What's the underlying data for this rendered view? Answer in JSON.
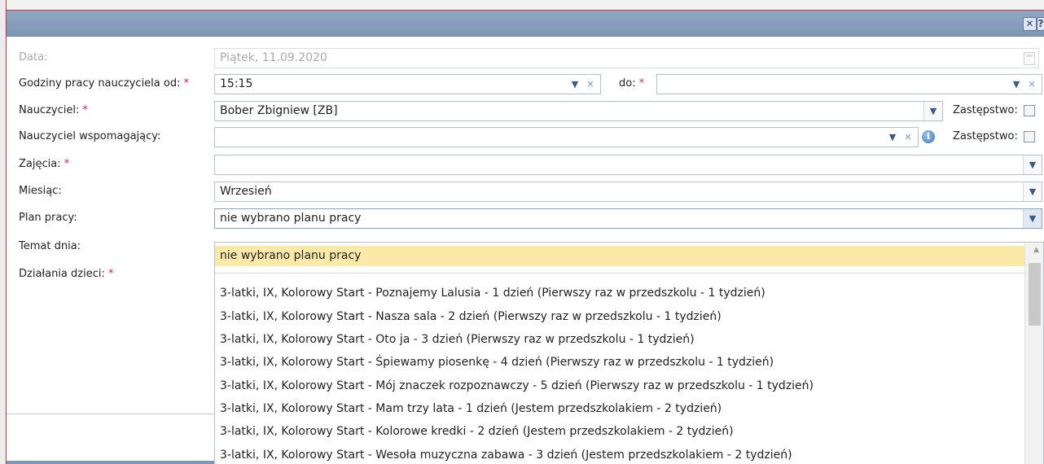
{
  "window": {
    "close_icon": "close-icon",
    "help_icon": "help-icon",
    "help_glyph": "?"
  },
  "form": {
    "date": {
      "label": "Data:",
      "value": "Piątek, 11.09.2020"
    },
    "hours": {
      "label": "Godziny pracy nauczyciela od:",
      "from_value": "15:15",
      "to_label": "do:",
      "to_value": ""
    },
    "teacher": {
      "label": "Nauczyciel:",
      "value": "Bober Zbigniew [ZB]",
      "substitute_label": "Zastępstwo:"
    },
    "assistant": {
      "label": "Nauczyciel wspomagający:",
      "value": "",
      "substitute_label": "Zastępstwo:"
    },
    "classes": {
      "label": "Zajęcia:",
      "value": ""
    },
    "month": {
      "label": "Miesiąc:",
      "value": "Wrzesień"
    },
    "plan": {
      "label": "Plan pracy:",
      "value": "nie wybrano planu pracy"
    },
    "topic": {
      "label": "Temat dnia:"
    },
    "activities": {
      "label": "Działania dzieci:"
    },
    "required_mark": "*"
  },
  "plan_dropdown": {
    "options": [
      "nie wybrano planu pracy",
      "3-latki, IX, Kolorowy Start - Poznajemy Lalusia - 1 dzień (Pierwszy raz w przedszkolu - 1 tydzień)",
      "3-latki, IX, Kolorowy Start - Nasza sala - 2 dzień (Pierwszy raz w przedszkolu - 1 tydzień)",
      "3-latki, IX, Kolorowy Start - Oto ja - 3 dzień (Pierwszy raz w przedszkolu - 1 tydzień)",
      "3-latki, IX, Kolorowy Start - Śpiewamy piosenkę - 4 dzień (Pierwszy raz w przedszkolu - 1 tydzień)",
      "3-latki, IX, Kolorowy Start - Mój znaczek rozpoznawczy - 5 dzień (Pierwszy raz w przedszkolu - 1 tydzień)",
      "3-latki, IX, Kolorowy Start - Mam trzy lata - 1 dzień (Jestem przedszkolakiem - 2 tydzień)",
      "3-latki, IX, Kolorowy Start - Kolorowe kredki - 2 dzień (Jestem przedszkolakiem - 2 tydzień)",
      "3-latki, IX, Kolorowy Start - Wesoła muzyczna zabawa - 3 dzień (Jestem przedszkolakiem - 2 tydzień)"
    ]
  },
  "colors": {
    "titlebar": "#7e97b6",
    "selected_option": "#fbe9a8",
    "required": "#e0223b"
  }
}
